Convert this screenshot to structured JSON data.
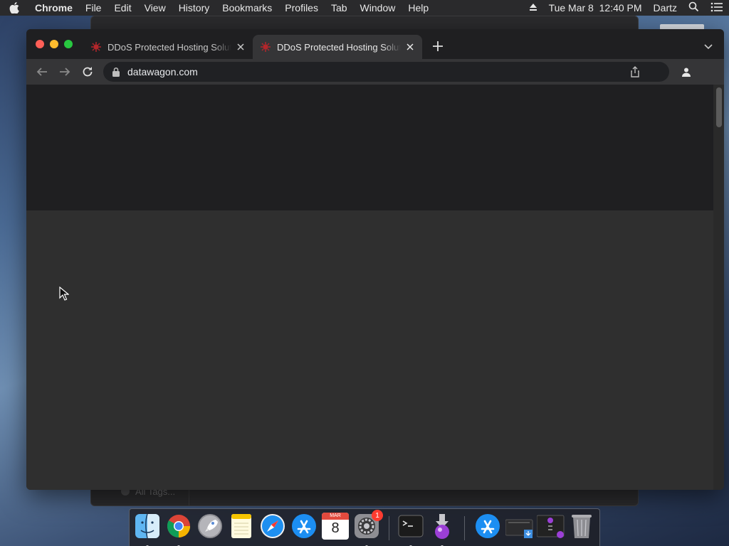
{
  "menubar": {
    "app": "Chrome",
    "items": [
      "File",
      "Edit",
      "View",
      "History",
      "Bookmarks",
      "Profiles",
      "Tab",
      "Window",
      "Help"
    ],
    "clock": "Tue Mar 8  12:40 PM",
    "user": "Dartz"
  },
  "background_window": {
    "sidebar_tag": "All Tags..."
  },
  "browser": {
    "tabs": [
      {
        "title": "DDoS Protected Hosting Solutions",
        "active": false
      },
      {
        "title": "DDoS Protected Hosting Solutions",
        "active": true
      }
    ],
    "url": "datawagon.com"
  },
  "dock": {
    "items": [
      {
        "name": "Finder",
        "icon": "finder-icon",
        "running": true
      },
      {
        "name": "Google Chrome",
        "icon": "chrome-icon",
        "running": true
      },
      {
        "name": "Launchpad",
        "icon": "rocket-icon",
        "running": false
      },
      {
        "name": "Notes",
        "icon": "notes-icon",
        "running": false
      },
      {
        "name": "Safari",
        "icon": "compass-icon",
        "running": false
      },
      {
        "name": "App Store",
        "icon": "app-store-icon",
        "running": false
      },
      {
        "name": "Calendar",
        "icon": "calendar-icon",
        "running": false,
        "month": "MAR",
        "day": "8"
      },
      {
        "name": "System Preferences",
        "icon": "gear-icon",
        "running": true,
        "badge": "1"
      },
      {
        "name": "Terminal",
        "icon": "terminal-icon",
        "running": true
      },
      {
        "name": "Installer",
        "icon": "installer-icon",
        "running": true
      },
      {
        "name": "App Store",
        "icon": "app-store-icon",
        "running": false
      },
      {
        "name": "Downloads",
        "icon": "downloads-stack-icon",
        "running": false
      },
      {
        "name": "Utilities",
        "icon": "utilities-stack-icon",
        "running": false
      },
      {
        "name": "Trash",
        "icon": "trash-icon",
        "running": false
      }
    ]
  }
}
